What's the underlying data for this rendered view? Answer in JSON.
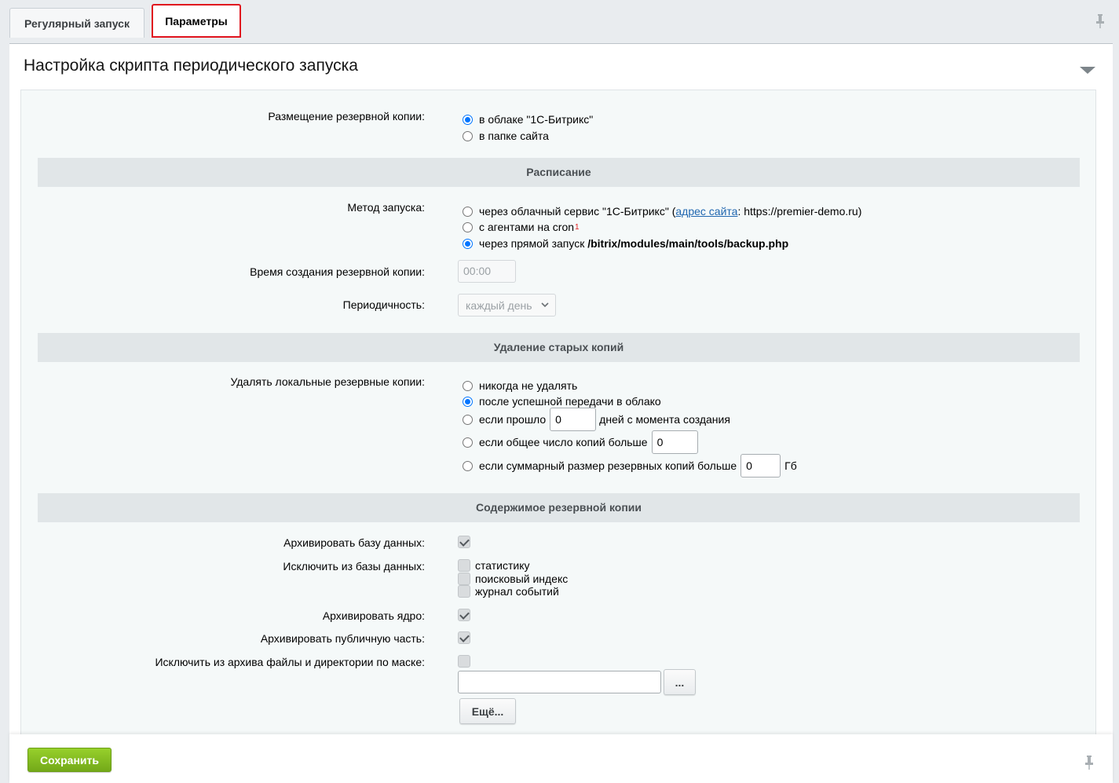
{
  "tabs": [
    {
      "label": "Регулярный запуск"
    },
    {
      "label": "Параметры"
    }
  ],
  "panel": {
    "title": "Настройка скрипта периодического запуска"
  },
  "placement": {
    "label": "Размещение резервной копии:",
    "options": [
      "в облаке \"1С-Битрикс\"",
      "в папке сайта"
    ],
    "selected": 0
  },
  "schedule": {
    "section_title": "Расписание",
    "method_label": "Метод запуска:",
    "method_options": {
      "cloud_prefix": "через облачный сервис \"1С-Битрикс\" (",
      "cloud_link": "адрес сайта",
      "cloud_suffix": ": https://premier-demo.ru)",
      "cron": "с агентами на cron",
      "cron_sup": "1",
      "direct_prefix": "через прямой запуск ",
      "direct_path": "/bitrix/modules/main/tools/backup.php"
    },
    "method_selected": 2,
    "time_label": "Время создания резервной копии:",
    "time_value": "00:00",
    "period_label": "Периодичность:",
    "period_value": "каждый день"
  },
  "deletion": {
    "section_title": "Удаление старых копий",
    "label": "Удалять локальные резервные копии:",
    "never": "никогда не удалять",
    "after_upload": "после успешной передачи в облако",
    "days_prefix": "если прошло",
    "days_value": "0",
    "days_suffix": "дней с момента создания",
    "count_prefix": "если общее число копий больше",
    "count_value": "0",
    "size_prefix": "если суммарный размер резервных копий больше",
    "size_value": "0",
    "size_unit": "Гб",
    "selected": 1
  },
  "content": {
    "section_title": "Содержимое резервной копии",
    "archive_db_label": "Архивировать базу данных:",
    "archive_db": true,
    "exclude_db_label": "Исключить из базы данных:",
    "exclude_db_options": [
      {
        "label": "статистику",
        "checked": false
      },
      {
        "label": "поисковый индекс",
        "checked": false
      },
      {
        "label": "журнал событий",
        "checked": false
      }
    ],
    "archive_core_label": "Архивировать ядро:",
    "archive_core": true,
    "archive_public_label": "Архивировать публичную часть:",
    "archive_public": true,
    "exclude_mask_label": "Исключить из архива файлы и директории по маске:",
    "exclude_mask": false,
    "mask_value": "",
    "browse_label": "...",
    "more_label": "Ещё..."
  },
  "footer": {
    "save_label": "Сохранить"
  }
}
